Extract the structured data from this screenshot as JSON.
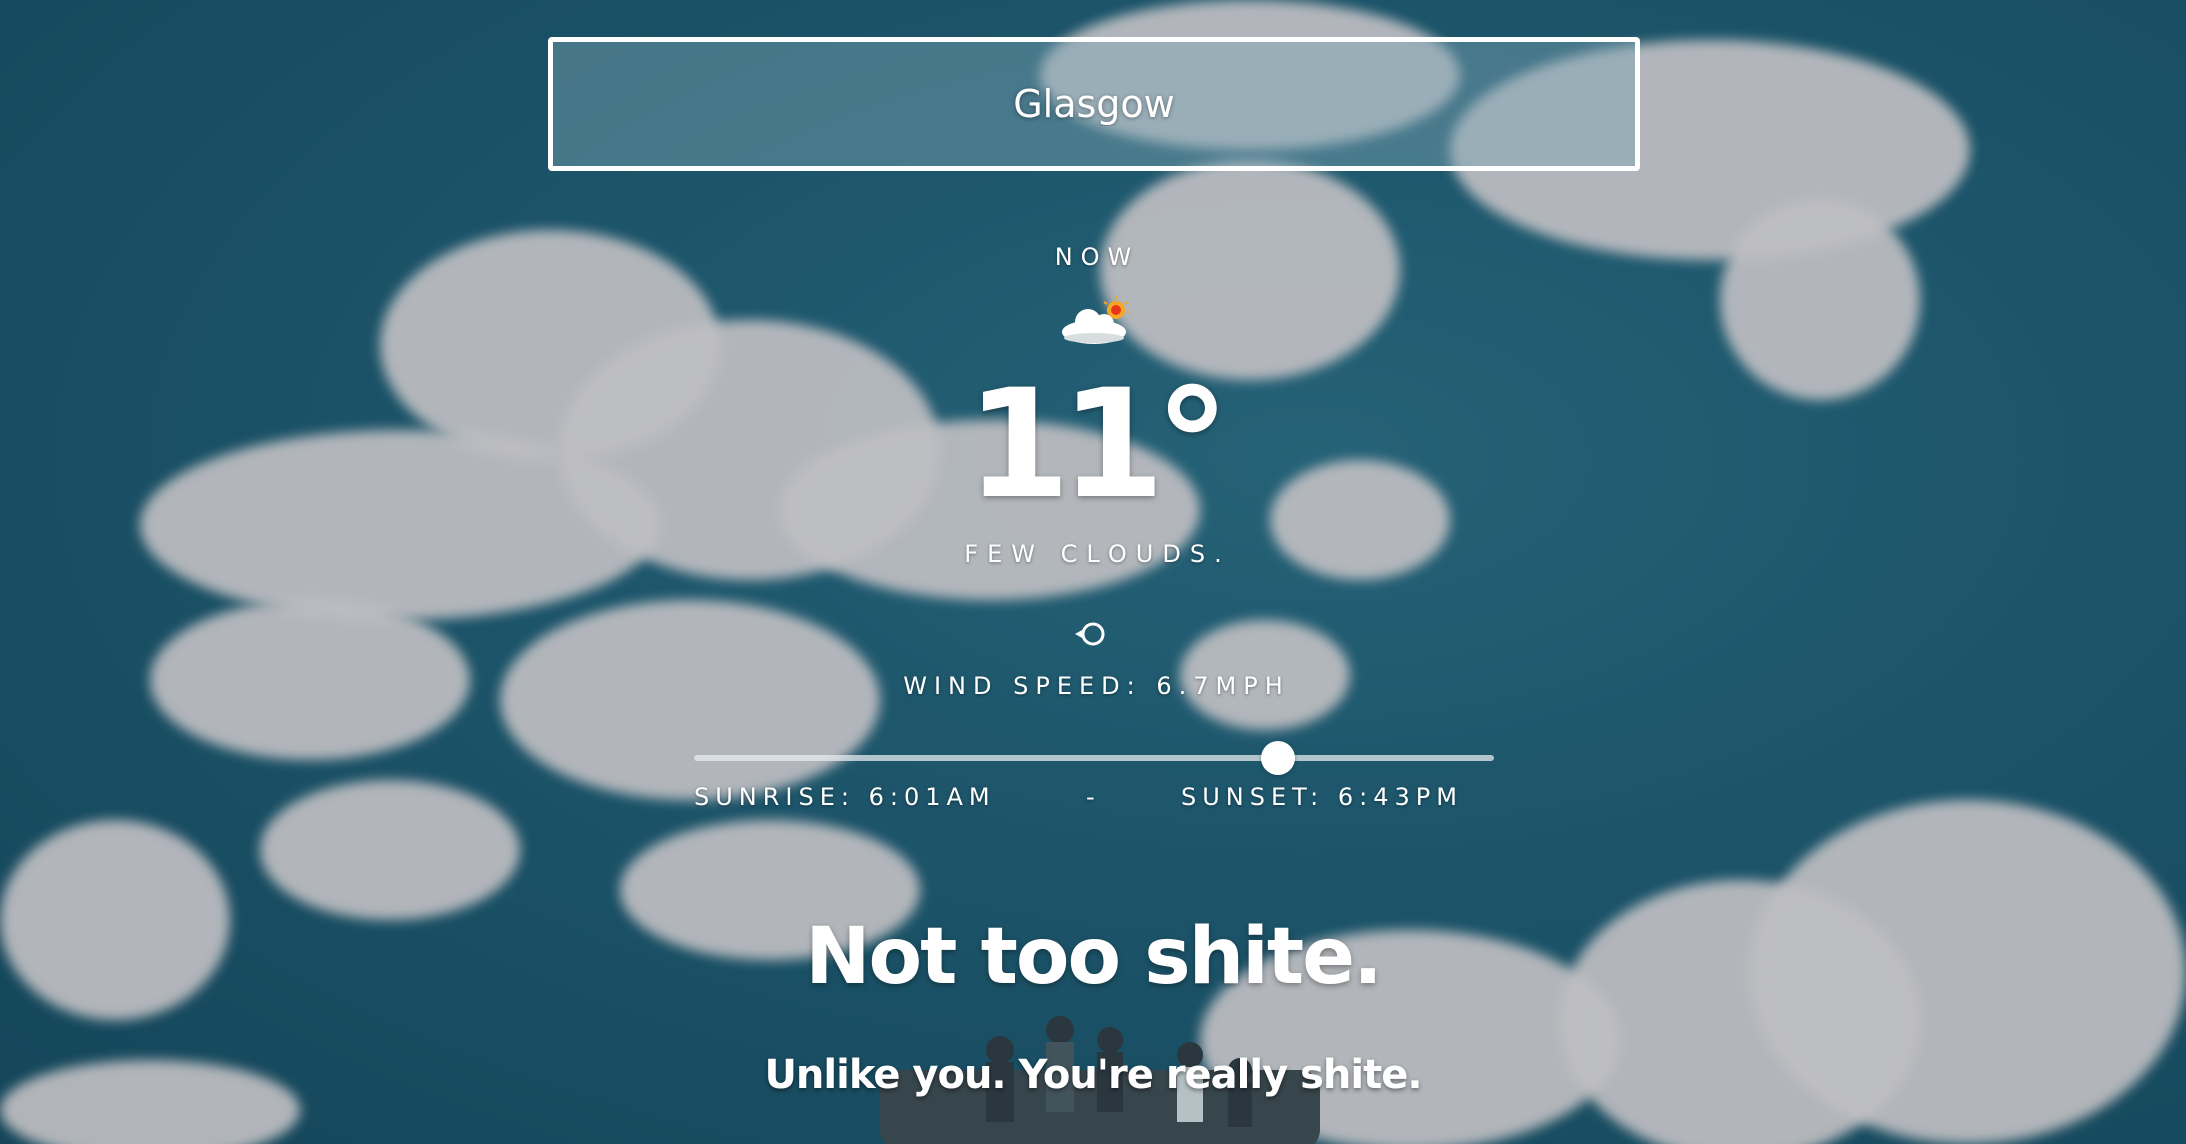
{
  "search": {
    "city_value": "Glasgow"
  },
  "current": {
    "now_label": "NOW",
    "weather_icon": "few-clouds-icon",
    "temperature": "11°",
    "description": "FEW CLOUDS.",
    "wind_icon": "wind-direction-icon",
    "wind_speed": "WIND SPEED: 6.7MPH"
  },
  "daylight": {
    "sunrise": "SUNRISE: 6:01AM",
    "separator": "-",
    "sunset": "SUNSET: 6:43PM",
    "progress_percent": 73
  },
  "verdict": {
    "headline": "Not too shite.",
    "subline": "Unlike you. You're really shite."
  }
}
